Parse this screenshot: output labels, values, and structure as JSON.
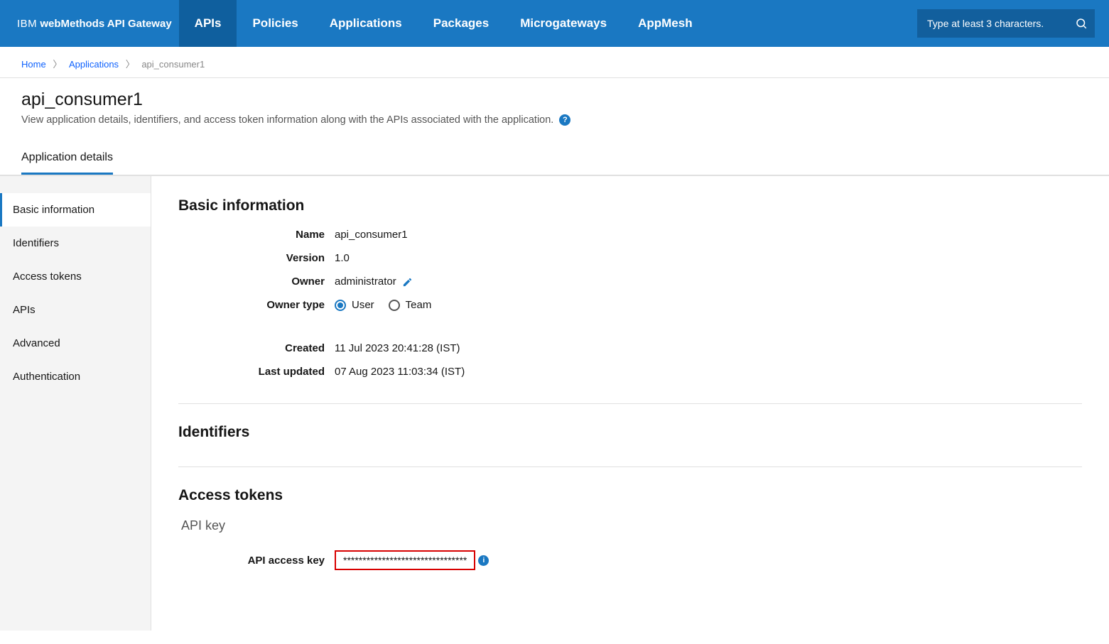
{
  "brand": {
    "ibm": "IBM",
    "product": "webMethods API Gateway"
  },
  "nav": {
    "apis": "APIs",
    "policies": "Policies",
    "applications": "Applications",
    "packages": "Packages",
    "microgateways": "Microgateways",
    "appmesh": "AppMesh"
  },
  "search": {
    "placeholder": "Type at least 3 characters."
  },
  "breadcrumbs": {
    "home": "Home",
    "applications": "Applications",
    "current": "api_consumer1"
  },
  "page": {
    "title": "api_consumer1",
    "subtitle": "View application details, identifiers, and access token information along with the APIs associated with the application."
  },
  "tabs": {
    "application_details": "Application details"
  },
  "sidebar": {
    "basic_information": "Basic information",
    "identifiers": "Identifiers",
    "access_tokens": "Access tokens",
    "apis": "APIs",
    "advanced": "Advanced",
    "authentication": "Authentication"
  },
  "basic_info": {
    "section_title": "Basic information",
    "name_label": "Name",
    "name_value": "api_consumer1",
    "version_label": "Version",
    "version_value": "1.0",
    "owner_label": "Owner",
    "owner_value": "administrator",
    "owner_type_label": "Owner type",
    "user_option": "User",
    "team_option": "Team",
    "owner_type_selected": "user",
    "created_label": "Created",
    "created_value": "11 Jul 2023 20:41:28 (IST)",
    "last_updated_label": "Last updated",
    "last_updated_value": "07 Aug 2023 11:03:34 (IST)"
  },
  "identifiers": {
    "section_title": "Identifiers"
  },
  "access_tokens": {
    "section_title": "Access tokens",
    "api_key_heading": "API key",
    "api_access_key_label": "API access key",
    "api_access_key_value": "********************************"
  }
}
